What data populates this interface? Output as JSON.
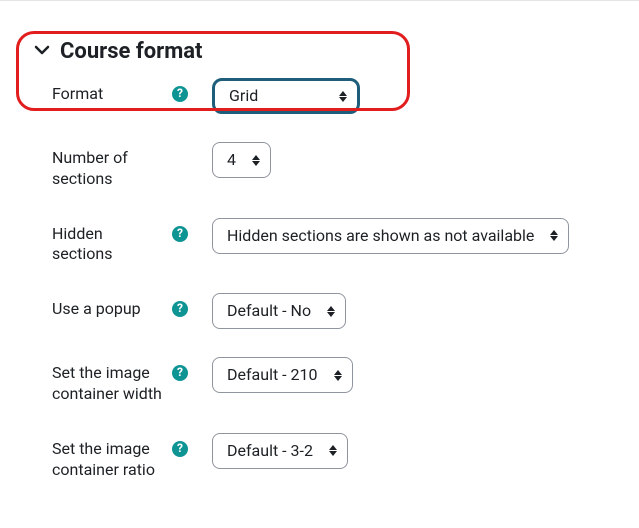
{
  "section": {
    "title": "Course format"
  },
  "fields": {
    "format": {
      "label": "Format",
      "value": "Grid",
      "has_help": true
    },
    "num_sections": {
      "label": "Number of sections",
      "value": "4",
      "has_help": false
    },
    "hidden_sections": {
      "label": "Hidden sections",
      "value": "Hidden sections are shown as not available",
      "has_help": true
    },
    "use_popup": {
      "label": "Use a popup",
      "value": "Default - No",
      "has_help": true
    },
    "image_container_width": {
      "label": "Set the image container width",
      "value": "Default - 210",
      "has_help": true
    },
    "image_container_ratio": {
      "label": "Set the image container ratio",
      "value": "Default - 3-2",
      "has_help": true
    }
  }
}
